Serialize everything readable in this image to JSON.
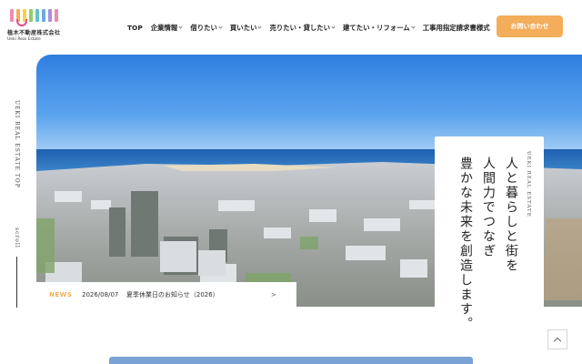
{
  "header": {
    "logo": {
      "company_jp": "植木不動産株式会社",
      "company_en": "Ueki Real Estate",
      "bar_colors": [
        "#f08ab0",
        "#f4ad5a",
        "#f6d24a",
        "#8fcf6a",
        "#5fc3c8",
        "#6ea8e6",
        "#a88fe0",
        "#f08ab0"
      ]
    },
    "nav": [
      {
        "label": "TOP",
        "dropdown": false
      },
      {
        "label": "企業情報",
        "dropdown": true
      },
      {
        "label": "借りたい",
        "dropdown": true
      },
      {
        "label": "買いたい",
        "dropdown": true
      },
      {
        "label": "売りたい・貸したい",
        "dropdown": true
      },
      {
        "label": "建てたい・リフォーム",
        "dropdown": true
      },
      {
        "label": "工事用指定請求書様式",
        "dropdown": false
      }
    ],
    "contact_label": "お問い合わせ",
    "accent_color": "#f4ad5a"
  },
  "side": {
    "page_label": "UEKI REAL ESTATE TOP",
    "scroll_label": "scroll"
  },
  "hero": {
    "tagline_en": "UEKI REAL ESTATE",
    "tagline_lines": [
      "人と暮らしと街を",
      "人間力でつなぎ",
      "豊かな未来を創造します。"
    ]
  },
  "news": {
    "label": "NEWS",
    "date": "2026/08/07",
    "title": "夏季休業日のお知らせ（2026）",
    "arrow": ">"
  },
  "pagetop": {
    "icon": "chevron-up-icon"
  }
}
